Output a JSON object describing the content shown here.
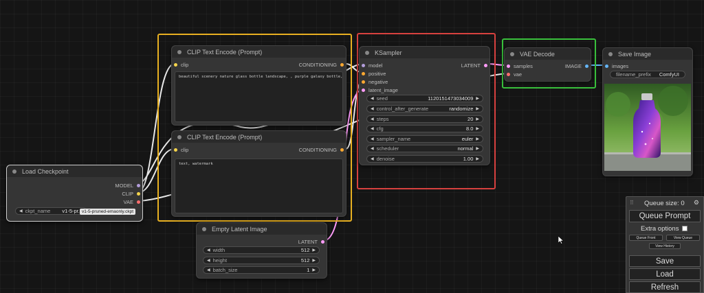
{
  "nodes": {
    "load_checkpoint": {
      "title": "Load Checkpoint",
      "outputs": [
        "MODEL",
        "CLIP",
        "VAE"
      ],
      "widget_name": "ckpt_name",
      "widget_value": "v1-5-pr...",
      "tooltip": "v1-5-pruned-emaonly.ckpt"
    },
    "clip_pos": {
      "title": "CLIP Text Encode (Prompt)",
      "input": "clip",
      "output": "CONDITIONING",
      "text": "beautiful scenery nature glass bottle landscape, , purple galaxy bottle,"
    },
    "clip_neg": {
      "title": "CLIP Text Encode (Prompt)",
      "input": "clip",
      "output": "CONDITIONING",
      "text": "text, watermark"
    },
    "ksampler": {
      "title": "KSampler",
      "inputs": [
        "model",
        "positive",
        "negative",
        "latent_image"
      ],
      "output": "LATENT",
      "widgets": [
        {
          "name": "seed",
          "value": "1120151473034009"
        },
        {
          "name": "control_after_generate",
          "value": "randomize"
        },
        {
          "name": "steps",
          "value": "20"
        },
        {
          "name": "cfg",
          "value": "8.0"
        },
        {
          "name": "sampler_name",
          "value": "euler"
        },
        {
          "name": "scheduler",
          "value": "normal"
        },
        {
          "name": "denoise",
          "value": "1.00"
        }
      ]
    },
    "vae_decode": {
      "title": "VAE Decode",
      "inputs": [
        "samples",
        "vae"
      ],
      "output": "IMAGE"
    },
    "save_image": {
      "title": "Save Image",
      "input": "images",
      "widget_name": "filename_prefix",
      "widget_value": "ComfyUI"
    },
    "empty_latent": {
      "title": "Empty Latent Image",
      "output": "LATENT",
      "widgets": [
        {
          "name": "width",
          "value": "512"
        },
        {
          "name": "height",
          "value": "512"
        },
        {
          "name": "batch_size",
          "value": "1"
        }
      ]
    }
  },
  "queue": {
    "size_label": "Queue size: 0",
    "queue_prompt": "Queue Prompt",
    "extra_options": "Extra options",
    "queue_front": "Queue Front",
    "view_queue": "View Queue",
    "view_history": "View History",
    "save": "Save",
    "load": "Load",
    "refresh": "Refresh"
  },
  "colors": {
    "frame_clip": "#e8b021",
    "frame_ksampler": "#d8413f",
    "frame_vae": "#39c13c",
    "wire_clip": "#f5d44c",
    "wire_model": "#b39ddb",
    "wire_conditioning": "#ffa931",
    "wire_latent": "#ff9cf9",
    "wire_vae": "#ff6e6e",
    "wire_image": "#64b5f6"
  }
}
